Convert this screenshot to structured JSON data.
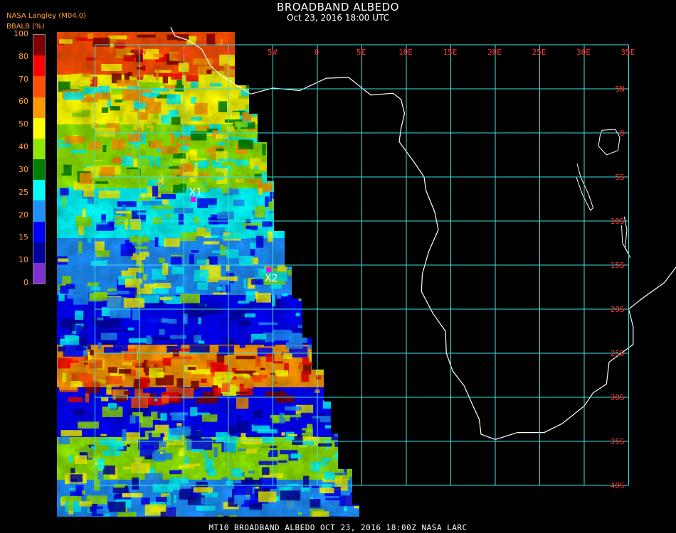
{
  "header": {
    "title": "BROADBAND ALBEDO",
    "subtitle": "Oct 23, 2016 18:00 UTC",
    "producer": "NASA Langley (M04.0)"
  },
  "colorbar": {
    "label": "BBALB (%)",
    "ticks": [
      "100",
      "80",
      "70",
      "60",
      "50",
      "40",
      "30",
      "25",
      "20",
      "15",
      "10",
      "0"
    ],
    "colors": [
      "#800000",
      "#ff0000",
      "#ff5000",
      "#ff9a00",
      "#ffff00",
      "#90e800",
      "#008000",
      "#00ffff",
      "#1e90ff",
      "#0000ff",
      "#0000a0",
      "#8030d0"
    ]
  },
  "map": {
    "lon_labels": [
      "20W",
      "15W",
      "10W",
      "5W",
      "0",
      "5E",
      "10E",
      "15E",
      "20E",
      "25E",
      "30E",
      "35E"
    ],
    "lat_labels": [
      "5N",
      "0",
      "5S",
      "10S",
      "15S",
      "20S",
      "25S",
      "30S",
      "35S",
      "40S"
    ],
    "markers": [
      {
        "label": "X1",
        "lon": -14.0,
        "lat": -7.5,
        "color": "#ff00ff"
      },
      {
        "label": "X2",
        "lon": -5.5,
        "lat": -15.5,
        "color": "#ff00ff"
      }
    ],
    "grid_color": "#40e0e0",
    "lon_label_color": "#ff3030",
    "lat_label_color": "#ff3030",
    "coast_color": "#ffffff",
    "extent": {
      "lon_min": -25,
      "lon_max": 35,
      "lat_min": -40,
      "lat_max": 10
    }
  },
  "footer": {
    "text": "MT10  BROADBAND ALBEDO   OCT 23, 2016 18:00Z   NASA LARC"
  }
}
